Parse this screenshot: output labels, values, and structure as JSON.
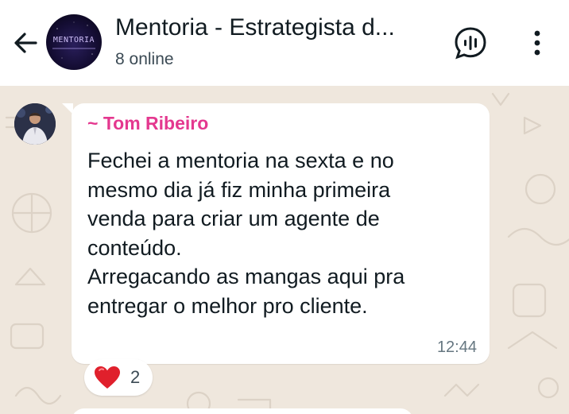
{
  "header": {
    "back_icon": "arrow-left-icon",
    "avatar_logo_text": "MENTORIA",
    "title": "Mentoria - Estrategista d...",
    "subtitle": "8 online",
    "voice_icon": "voice-chat-icon",
    "menu_icon": "more-vertical-icon"
  },
  "message": {
    "sender": "~ Tom Ribeiro",
    "text": "Fechei a mentoria na sexta e no\nmesmo dia já fiz minha primeira\nvenda para criar um agente de\nconteúdo.\nArregacando as mangas aqui pra\nentregar o melhor pro cliente.",
    "time": "12:44",
    "reaction": {
      "emoji_icon": "red-heart-icon",
      "count": "2"
    }
  },
  "colors": {
    "sender_name": "#e4388f",
    "header_bg": "#ffffff",
    "chat_bg": "#efe7dd",
    "bubble_bg": "#ffffff",
    "heart": "#e0202c"
  }
}
